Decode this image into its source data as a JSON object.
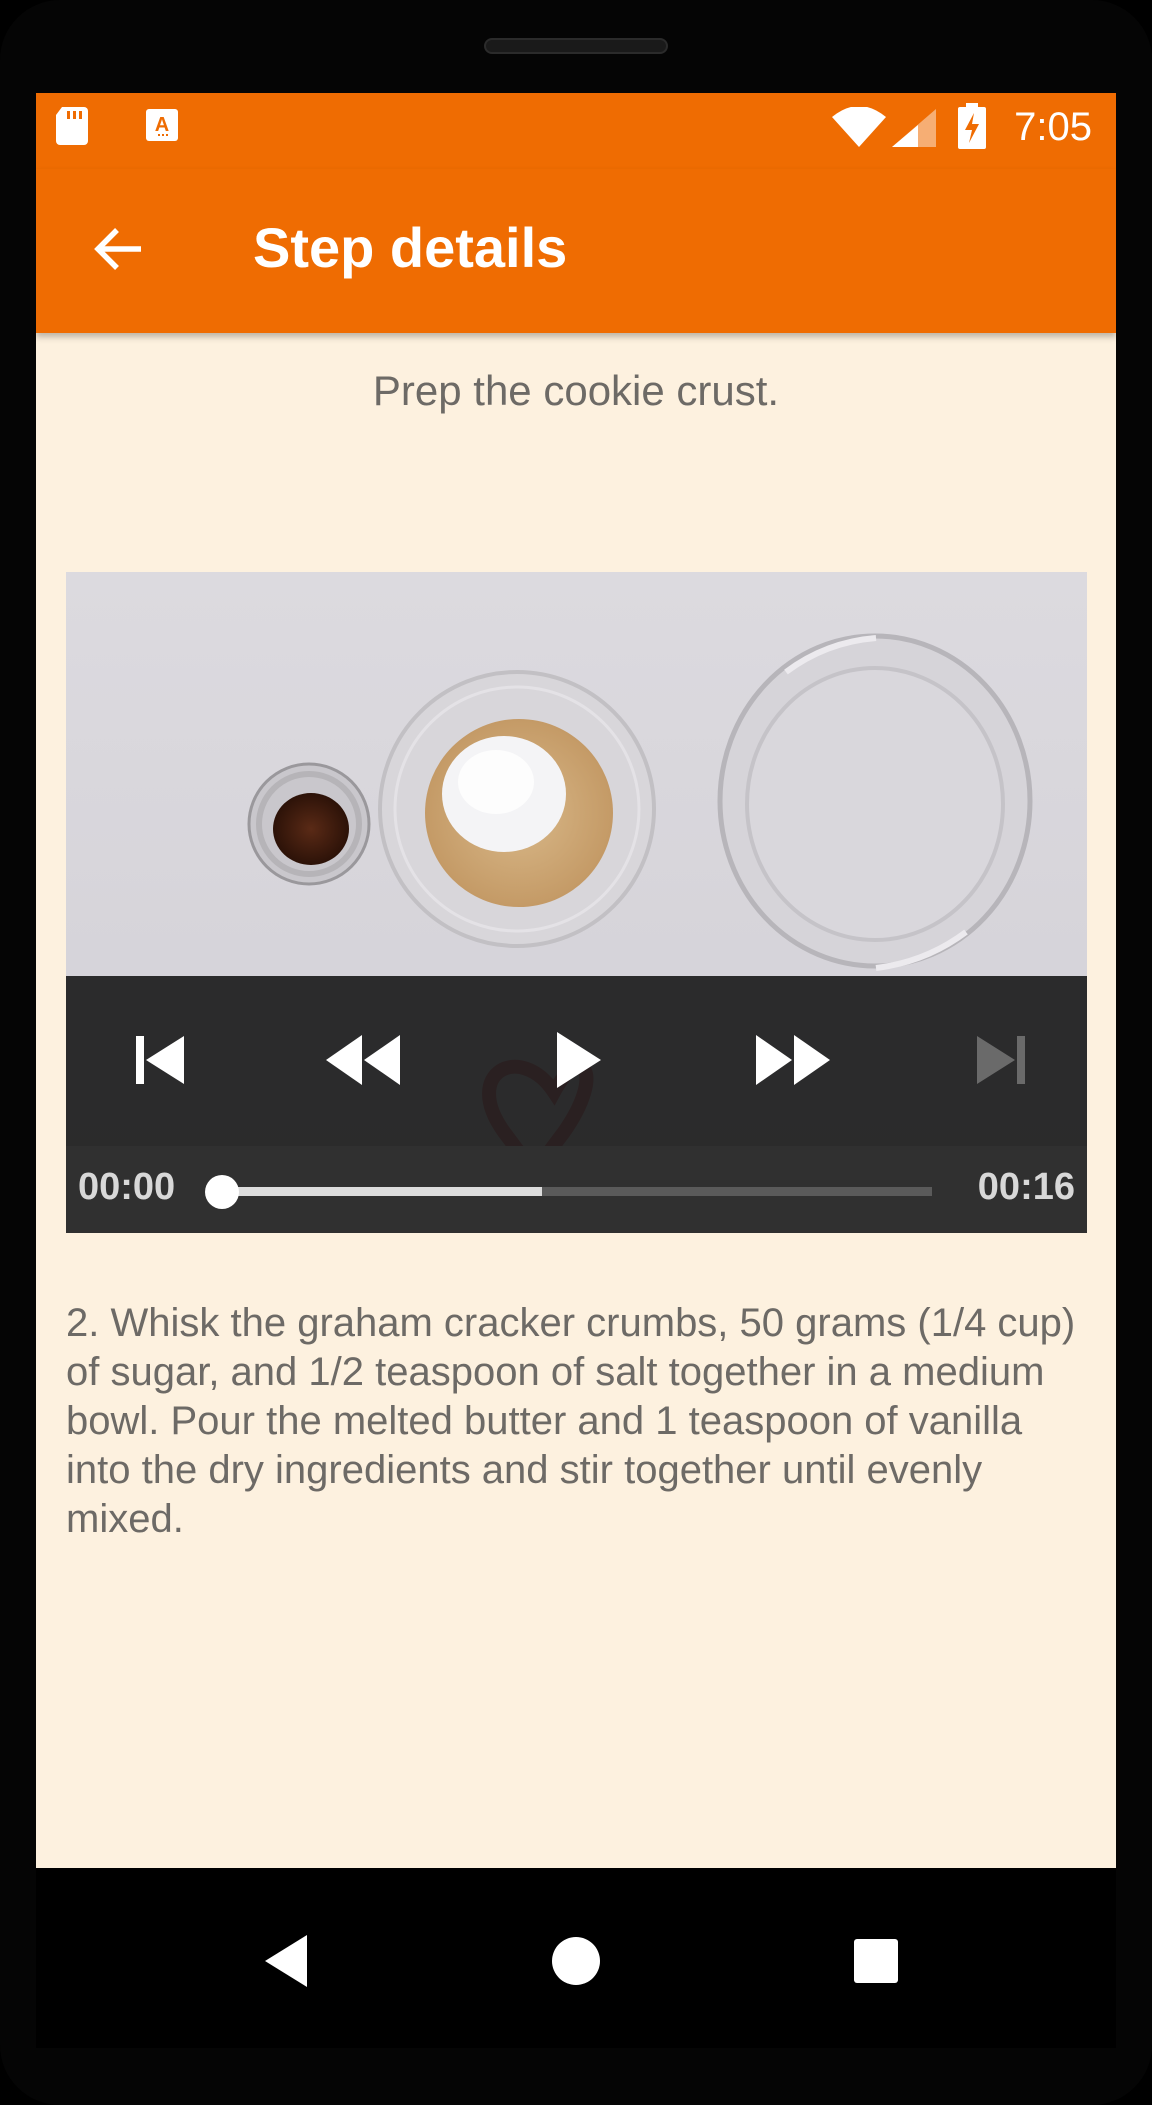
{
  "status_bar": {
    "time": "7:05",
    "icons": [
      "sd-card-icon",
      "a-keyboard-icon",
      "wifi-icon",
      "cell-signal-icon",
      "battery-charging-icon"
    ]
  },
  "app_bar": {
    "title": "Step details",
    "back_icon": "arrow-left-icon",
    "color": "#ef6c02"
  },
  "step": {
    "short_description": "Prep the cookie crust.",
    "description": "2. Whisk the graham cracker crumbs, 50 grams (1/4 cup) of sugar, and 1/2 teaspoon of salt together in a medium bowl. Pour the melted butter and 1 teaspoon of vanilla into the dry ingredients and stir together until evenly mixed."
  },
  "player": {
    "controls": [
      "skip-previous-icon",
      "rewind-icon",
      "play-icon",
      "fast-forward-icon",
      "skip-next-icon"
    ],
    "position": "00:00",
    "duration": "00:16",
    "buffered_fraction": 0.45,
    "played_fraction": 0.0
  },
  "nav_bar": {
    "icons": [
      "nav-back-icon",
      "nav-home-icon",
      "nav-recents-icon"
    ]
  },
  "colors": {
    "accent": "#ef6c02",
    "background": "#fdf1df",
    "text": "#6d6a66"
  }
}
